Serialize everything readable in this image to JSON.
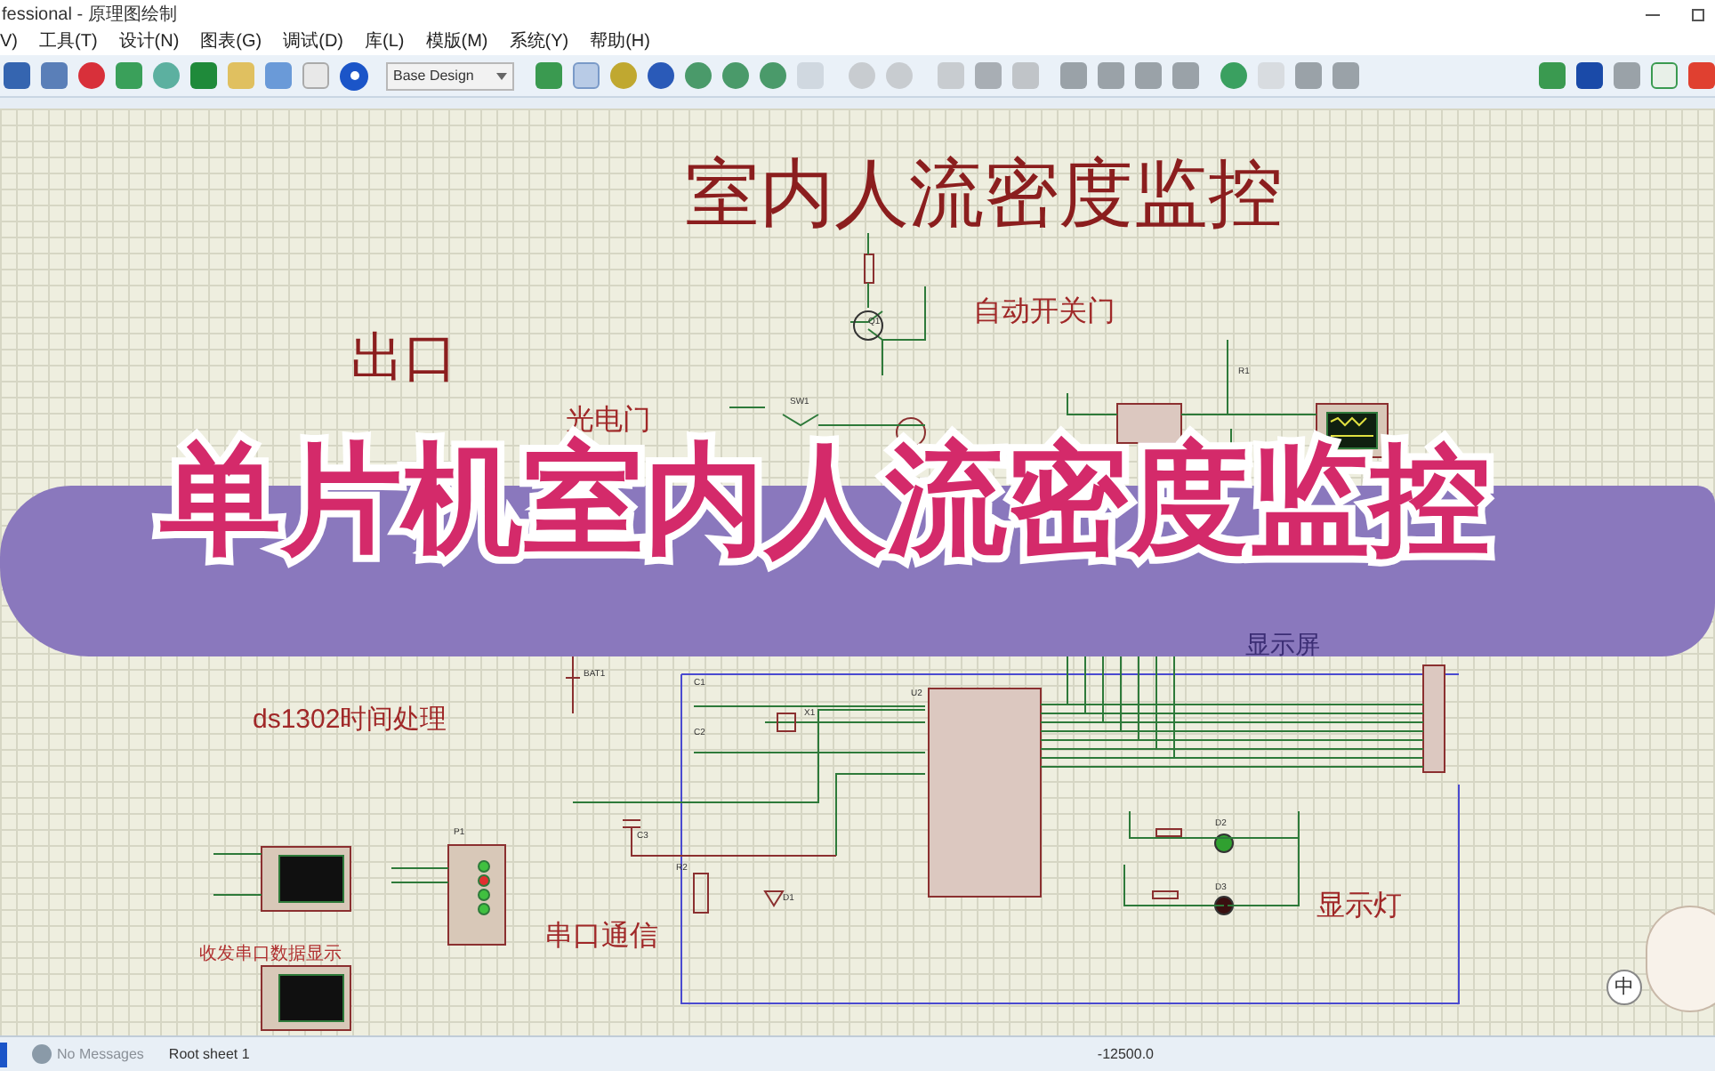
{
  "window": {
    "title": "fessional - 原理图绘制"
  },
  "menu": [
    "V)",
    "工具(T)",
    "设计(N)",
    "图表(G)",
    "调试(D)",
    "库(L)",
    "模版(M)",
    "系统(Y)",
    "帮助(H)"
  ],
  "toolbar": {
    "design_select": "Base Design"
  },
  "schematic": {
    "title": "室内人流密度监控",
    "labels": [
      {
        "kind": "large",
        "text": "出口"
      },
      {
        "kind": "medium",
        "text": "光电门"
      },
      {
        "kind": "medium",
        "text": "自动开关门"
      },
      {
        "kind": "medium",
        "text": "ds1302时间处理"
      },
      {
        "kind": "faded",
        "text": "显示屏"
      },
      {
        "kind": "medium",
        "text": "串口通信"
      },
      {
        "kind": "medium",
        "text": "显示灯"
      },
      {
        "kind": "small",
        "text": "收发串口数据显示"
      }
    ],
    "parts": [
      "U2",
      "P1",
      "C1",
      "C2",
      "C3",
      "X1",
      "R2",
      "D1",
      "BAT1",
      "Q1",
      "SW1",
      "R1",
      "D2",
      "D3"
    ]
  },
  "banner": {
    "text": "单片机室内人流密度监控"
  },
  "ime_indicator": "中",
  "status_bar": {
    "messages": "No Messages",
    "sheet": "Root sheet 1",
    "coordinate": "-12500.0"
  }
}
